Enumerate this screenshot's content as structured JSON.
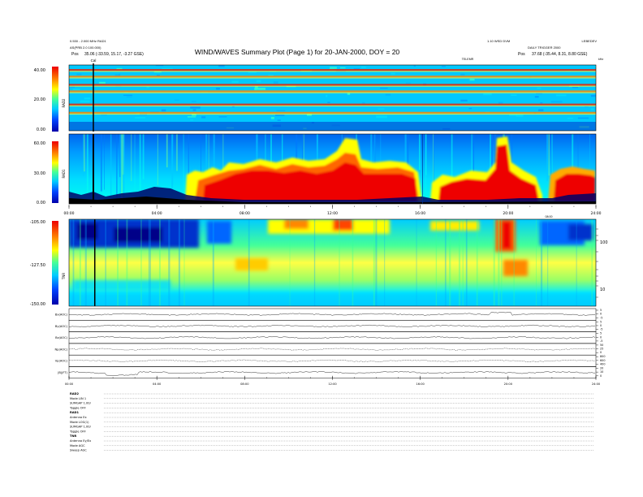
{
  "header": {
    "title": "WIND/WAVES Summary Plot (Page 1) for 20-JAN-2000, DOY = 20",
    "left_line1": "0.530 - 2.000 MHz RAD1",
    "left_line2": "AS(PRB 2.0 100.000)",
    "left_pos_label": "Pos",
    "left_pos_value": "35.06 (-33.59, 15.17, -3.27 GSE)",
    "right_top": "1.10 WSD DVM",
    "right_top_far": "LEBEDEV",
    "right_line2": "DAILY TRIGGER 2000",
    "right_pos_label": "Pos",
    "right_pos_value": "37.68 (-35.44, 8.31, 8.80 GSE)",
    "cal_label": "Cal",
    "tnr_label": "TELEMR",
    "khz_label": "kHz",
    "rad2_time_label": "08:00"
  },
  "colors": {
    "palette": [
      "#000088",
      "#0000ff",
      "#0066ff",
      "#00ccff",
      "#00ffcc",
      "#66ff66",
      "#ffff00",
      "#ffaa00",
      "#ff4400",
      "#ee0000"
    ]
  },
  "panels": {
    "rad2": {
      "name": "RAD2",
      "ticks": [
        "40.00",
        "20.00",
        "0.00"
      ]
    },
    "rad1": {
      "name": "RAD1",
      "ticks": [
        "60.00",
        "30.00",
        "0.00"
      ]
    },
    "tnr": {
      "name": "TNR",
      "ticks": [
        "-105.00",
        "-127.50",
        "-150.00"
      ],
      "right_ticks": [
        "100",
        "10"
      ]
    }
  },
  "time_ticks": [
    "00:00",
    "04:00",
    "08:00",
    "12:00",
    "16:00",
    "20:00",
    "24:00"
  ],
  "trace_panels": [
    {
      "label": "Bx(AOC)",
      "right_ticks": [
        "5",
        "0",
        "-5"
      ]
    },
    {
      "label": "By(AOC)",
      "right_ticks": [
        "5",
        "0",
        "-5"
      ]
    },
    {
      "label": "Bz(AOC)",
      "right_ticks": [
        "5",
        "0",
        "-5"
      ]
    },
    {
      "label": "Np(AOC)",
      "right_ticks": [
        "50",
        "25",
        "0"
      ]
    },
    {
      "label": "Vp(AOC)",
      "right_ticks": [
        "800",
        "600",
        "400"
      ]
    },
    {
      "label": "|B|(FT)",
      "right_ticks": [
        "20",
        "10",
        "0"
      ]
    }
  ],
  "footer": {
    "lines": [
      "RAD2",
      "Mode   LIN 1",
      "SUMGAP 1.00/",
      "Toggle   OFF",
      "RAD1",
      "Antenna   Ex",
      "Mode  LOG(1)",
      "SUMGAP 1.00/",
      "Toggle   OFF",
      "TNR",
      "Antenna  Ey/Ex",
      "Mode   AGC",
      "Sweep   AGC"
    ]
  },
  "chart_data": [
    {
      "type": "heatmap",
      "title": "RAD2",
      "x_range": [
        "00:00",
        "24:00"
      ],
      "ylim": [
        0,
        40
      ],
      "ticks": [
        "40.00",
        "20.00",
        "0.00"
      ],
      "description_features": [
        {
          "feature": "horizontal interference bands",
          "y_values": [
            37,
            33,
            28,
            24,
            16,
            11
          ]
        }
      ]
    },
    {
      "type": "heatmap",
      "title": "RAD1",
      "x_range": [
        "00:00",
        "24:00"
      ],
      "ylim": [
        0,
        60
      ],
      "ticks": [
        "60.00",
        "30.00",
        "0.00"
      ]
    },
    {
      "type": "heatmap",
      "title": "TNR",
      "x_range": [
        "00:00",
        "24:00"
      ],
      "ylim": [
        -150,
        -105
      ],
      "ticks": [
        "-105.00",
        "-127.50",
        "-150.00"
      ],
      "right_axis": {
        "label": "kHz",
        "ticks": [
          "100",
          "10"
        ],
        "scale": "log"
      }
    }
  ]
}
